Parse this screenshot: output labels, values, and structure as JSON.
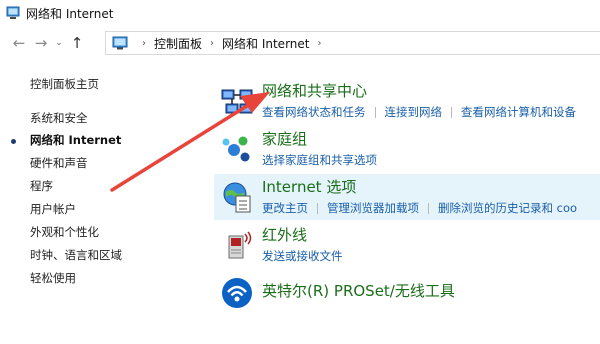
{
  "window": {
    "title": "网络和 Internet"
  },
  "nav": {
    "back_icon": "back-arrow-icon",
    "forward_icon": "forward-arrow-icon",
    "up_icon": "up-arrow-icon",
    "breadcrumb": [
      "控制面板",
      "网络和 Internet"
    ]
  },
  "sidebar": {
    "items": [
      {
        "label": "控制面板主页",
        "active": false
      },
      {
        "label": "系统和安全",
        "active": false
      },
      {
        "label": "网络和 Internet",
        "active": true
      },
      {
        "label": "硬件和声音",
        "active": false
      },
      {
        "label": "程序",
        "active": false
      },
      {
        "label": "用户帐户",
        "active": false
      },
      {
        "label": "外观和个性化",
        "active": false
      },
      {
        "label": "时钟、语言和区域",
        "active": false
      },
      {
        "label": "轻松使用",
        "active": false
      }
    ]
  },
  "categories": [
    {
      "title": "网络和共享中心",
      "icon": "network-sharing-center-icon",
      "links": [
        "查看网络状态和任务",
        "连接到网络",
        "查看网络计算机和设备"
      ]
    },
    {
      "title": "家庭组",
      "icon": "homegroup-icon",
      "links": [
        "选择家庭组和共享选项"
      ]
    },
    {
      "title": "Internet 选项",
      "icon": "internet-options-icon",
      "links": [
        "更改主页",
        "管理浏览器加载项",
        "删除浏览的历史记录和 coo"
      ]
    },
    {
      "title": "红外线",
      "icon": "infrared-icon",
      "links": [
        "发送或接收文件"
      ]
    },
    {
      "title": "英特尔(R) PROSet/无线工具",
      "icon": "intel-wireless-icon",
      "links": []
    }
  ],
  "colors": {
    "category_title": "#1a6e1a",
    "link": "#1a5fa8",
    "highlight": "#e5f3fb",
    "annotation_arrow": "#e8443a"
  }
}
